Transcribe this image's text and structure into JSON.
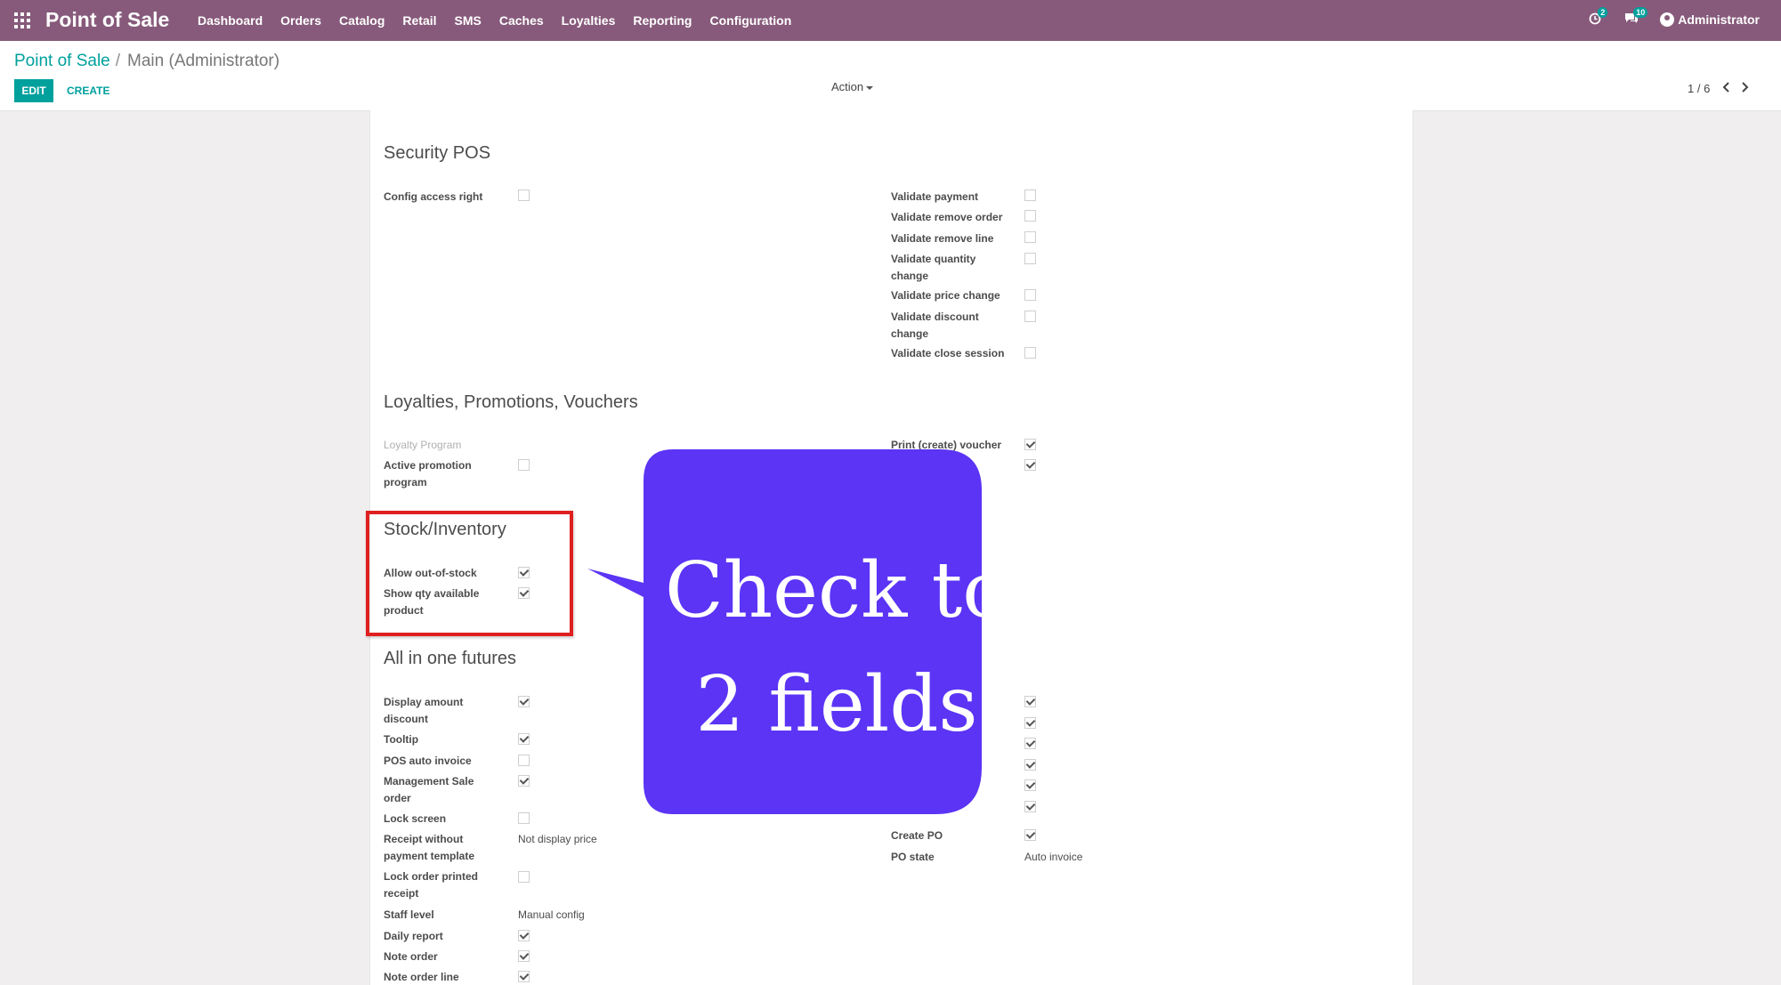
{
  "topbar": {
    "app_title": "Point of Sale",
    "menu": [
      "Dashboard",
      "Orders",
      "Catalog",
      "Retail",
      "SMS",
      "Caches",
      "Loyalties",
      "Reporting",
      "Configuration"
    ],
    "activity_badge": "2",
    "messages_badge": "10",
    "user": "Administrator",
    "bar_color": "#875a7b"
  },
  "breadcrumb": {
    "parent": "Point of Sale",
    "separator": "/",
    "current": "Main (Administrator)"
  },
  "buttons": {
    "edit": "EDIT",
    "create": "CREATE",
    "action": "Action"
  },
  "pager": {
    "text": "1 / 6"
  },
  "sections": {
    "security": {
      "title": "Security POS",
      "left": [
        {
          "label": "Config access right",
          "checked": false
        }
      ],
      "right": [
        {
          "label": "Validate payment",
          "checked": false
        },
        {
          "label": "Validate remove order",
          "checked": false
        },
        {
          "label": "Validate remove line",
          "checked": false
        },
        {
          "label": "Validate quantity change",
          "checked": false
        },
        {
          "label": "Validate price change",
          "checked": false
        },
        {
          "label": "Validate discount change",
          "checked": false
        },
        {
          "label": "Validate close session",
          "checked": false
        }
      ]
    },
    "loyalties": {
      "title": "Loyalties, Promotions, Vouchers",
      "left": [
        {
          "label": "Loyalty Program"
        },
        {
          "label": "Active promotion program",
          "checked": false
        }
      ],
      "right": [
        {
          "label": "Print (create) voucher",
          "checked": true
        }
      ]
    },
    "stock": {
      "title": "Stock/Inventory",
      "left": [
        {
          "label": "Allow out-of-stock",
          "checked": true
        },
        {
          "label": "Show qty available product",
          "checked": true
        }
      ]
    },
    "allinone": {
      "title": "All in one futures",
      "left": [
        {
          "label": "Display amount discount",
          "checked": true
        },
        {
          "label": "Tooltip",
          "checked": true
        },
        {
          "label": "POS auto invoice",
          "checked": false
        },
        {
          "label": "Management Sale order",
          "checked": true
        },
        {
          "label": "Lock screen",
          "checked": false
        },
        {
          "label": "Receipt without payment template",
          "value": "Not display price"
        },
        {
          "label": "Lock order printed receipt",
          "checked": false
        },
        {
          "label": "Staff level",
          "value": "Manual config"
        },
        {
          "label": "Daily report",
          "checked": true
        },
        {
          "label": "Note order",
          "checked": true
        },
        {
          "label": "Note order line",
          "checked": true
        }
      ],
      "right": [
        {
          "label": "Create PO",
          "checked": true
        },
        {
          "label": "PO state",
          "value": "Auto invoice"
        }
      ]
    }
  },
  "annotation": {
    "line1": "Check to",
    "line2": "2 fields",
    "bubble_color": "#5b34f5",
    "box_color": "#e02020"
  }
}
